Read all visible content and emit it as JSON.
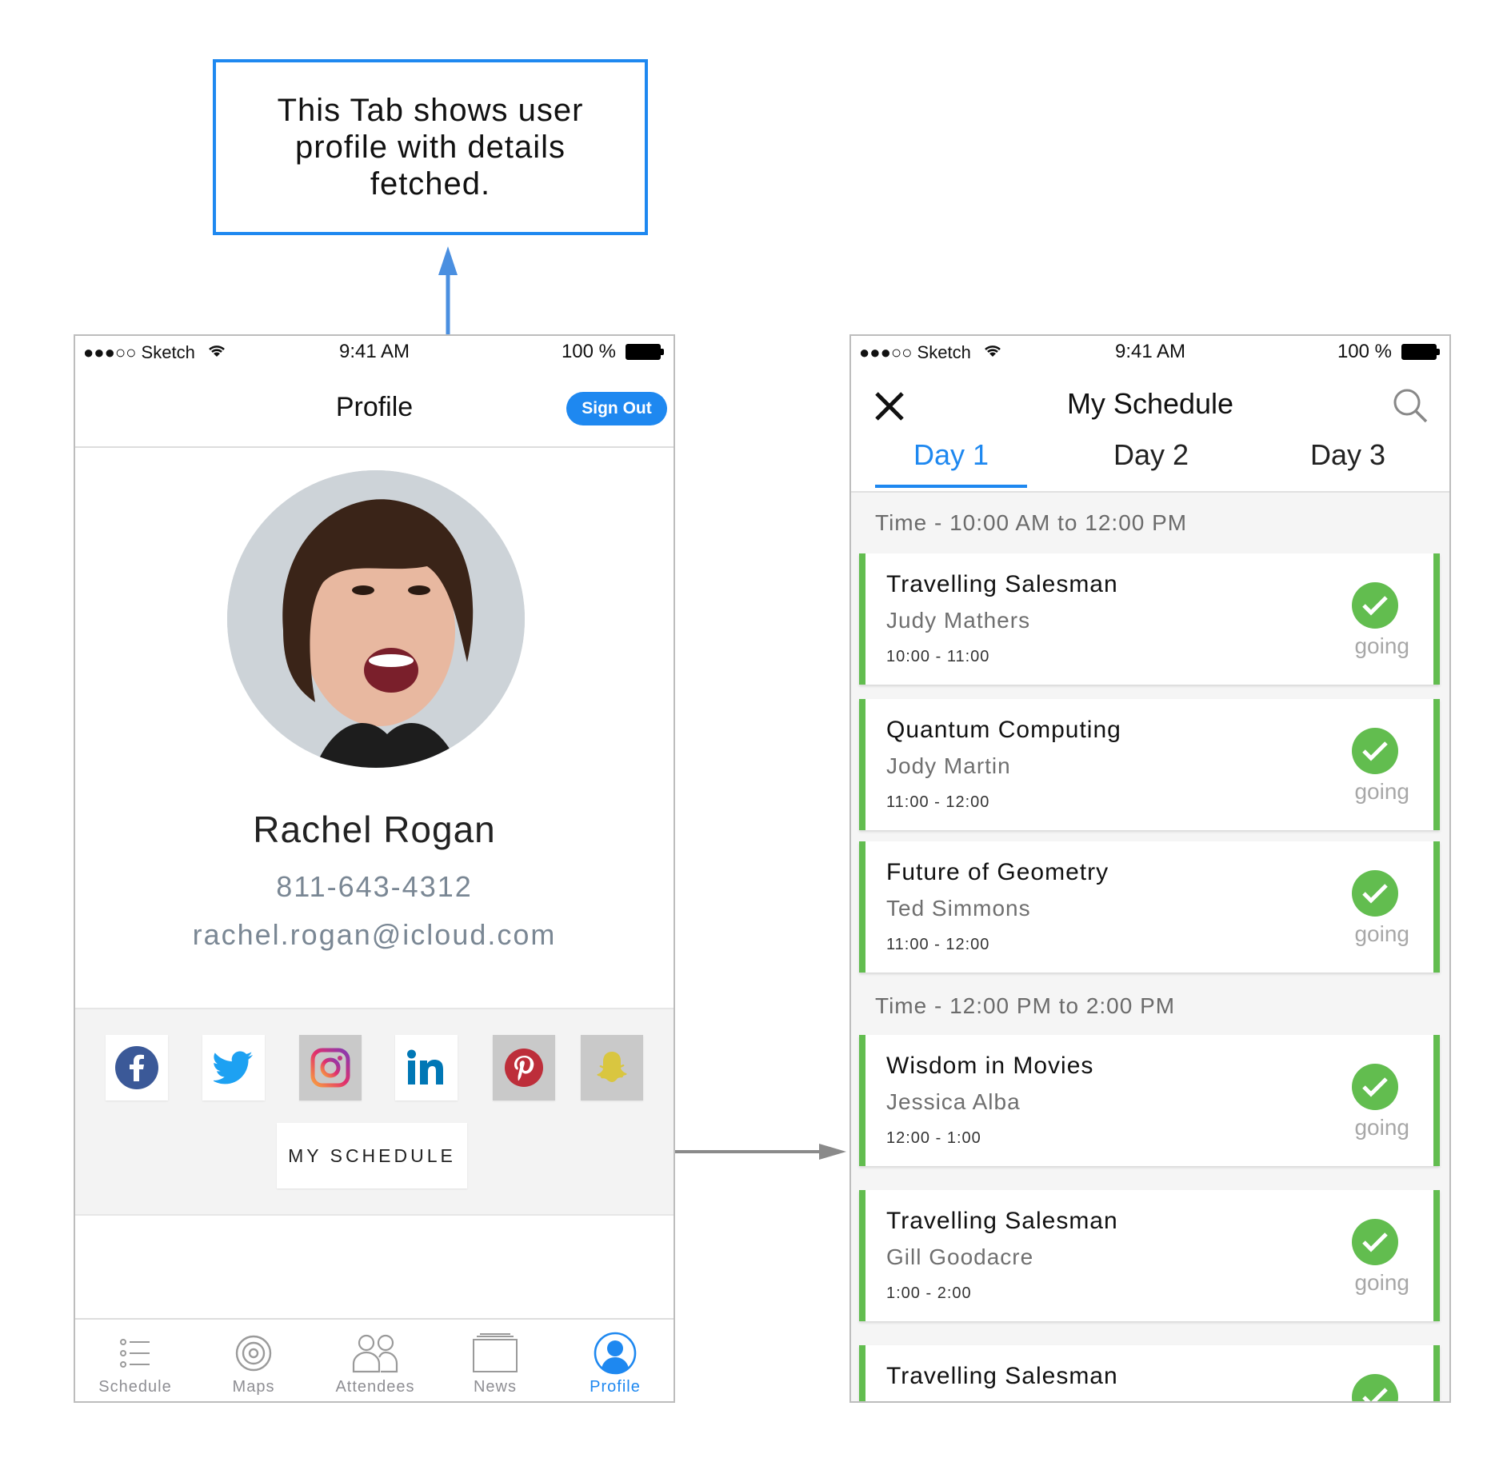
{
  "annotation": {
    "text": "This Tab shows user profile with details fetched."
  },
  "colors": {
    "accent": "#1e88f0",
    "going": "#62bd4f",
    "muted": "#7a8794"
  },
  "profile_screen": {
    "status": {
      "carrier": "●●●○○ Sketch",
      "time": "9:41 AM",
      "battery": "100 %"
    },
    "nav": {
      "title": "Profile",
      "sign_out": "Sign Out"
    },
    "user": {
      "name": "Rachel Rogan",
      "phone": "811-643-4312",
      "email": "rachel.rogan@icloud.com"
    },
    "social_icons": [
      "facebook-icon",
      "twitter-icon",
      "instagram-icon",
      "linkedin-icon",
      "pinterest-icon",
      "snapchat-icon"
    ],
    "my_schedule_button": "MY SCHEDULE",
    "tabs": [
      {
        "label": "Schedule",
        "icon": "schedule-list-icon"
      },
      {
        "label": "Maps",
        "icon": "maps-target-icon"
      },
      {
        "label": "Attendees",
        "icon": "attendees-icon"
      },
      {
        "label": "News",
        "icon": "news-icon"
      },
      {
        "label": "Profile",
        "icon": "profile-icon",
        "active": true
      }
    ]
  },
  "schedule_screen": {
    "status": {
      "carrier": "●●●○○ Sketch",
      "time": "9:41 AM",
      "battery": "100 %"
    },
    "title": "My Schedule",
    "days": [
      "Day 1",
      "Day 2",
      "Day 3"
    ],
    "active_day": "Day 1",
    "sections": [
      {
        "heading": "Time - 10:00 AM to 12:00 PM",
        "sessions": [
          {
            "title": "Travelling Salesman",
            "speaker": "Judy Mathers",
            "time": "10:00 - 11:00",
            "status": "going"
          },
          {
            "title": "Quantum Computing",
            "speaker": "Jody Martin",
            "time": "11:00 - 12:00",
            "status": "going"
          },
          {
            "title": "Future of Geometry",
            "speaker": "Ted Simmons",
            "time": "11:00 - 12:00",
            "status": "going"
          }
        ]
      },
      {
        "heading": "Time - 12:00 PM to 2:00 PM",
        "sessions": [
          {
            "title": "Wisdom in Movies",
            "speaker": "Jessica Alba",
            "time": "12:00 - 1:00",
            "status": "going"
          },
          {
            "title": "Travelling Salesman",
            "speaker": "Gill Goodacre",
            "time": "1:00 - 2:00",
            "status": "going"
          },
          {
            "title": "Travelling Salesman",
            "speaker": "",
            "time": "",
            "status": ""
          }
        ]
      }
    ]
  }
}
